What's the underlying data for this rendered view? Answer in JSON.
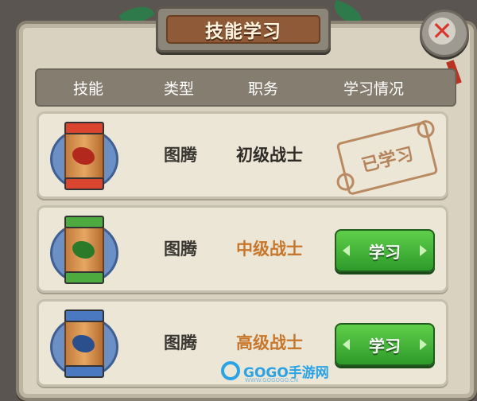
{
  "dialog": {
    "title": "技能学习",
    "close_label": "✕"
  },
  "header": {
    "columns": [
      "技能",
      "类型",
      "职务",
      "学习情况"
    ]
  },
  "rows": [
    {
      "skill_icon": "red-totem-icon",
      "type": "图腾",
      "job": "初级战士",
      "status": "已学习",
      "learned": true
    },
    {
      "skill_icon": "green-totem-icon",
      "type": "图腾",
      "job": "中级战士",
      "status": "学习",
      "learned": false
    },
    {
      "skill_icon": "blue-totem-icon",
      "type": "图腾",
      "job": "高级战士",
      "status": "学习",
      "learned": false
    }
  ],
  "colors": {
    "job_learned": "#2f2b27",
    "job_unlearned": "#c7772b",
    "learn_button": "#3fb23a",
    "stamp": "#b5835b"
  },
  "watermark": {
    "text": "GOGO手游网",
    "sub": "WWW.GOGOGO.CN"
  }
}
